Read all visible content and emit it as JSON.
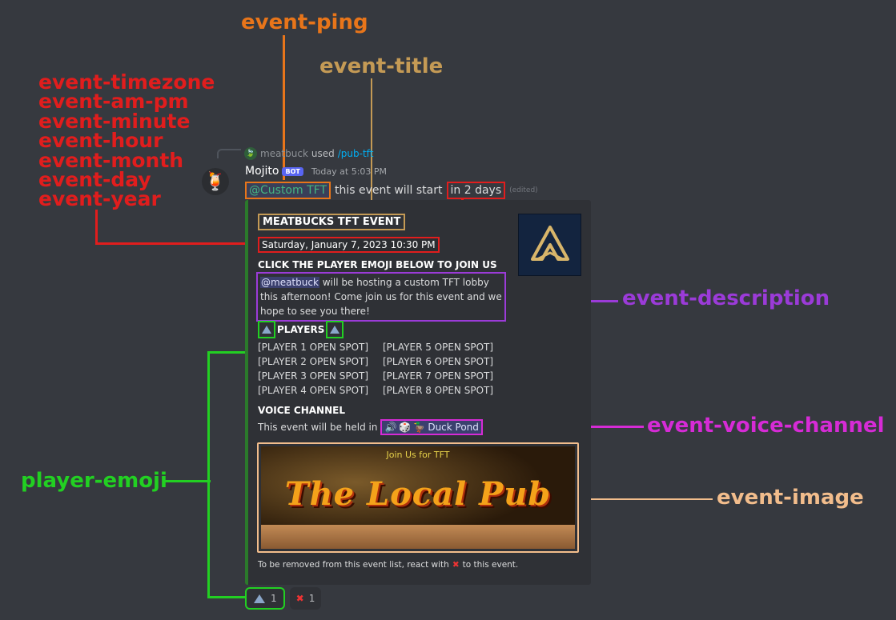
{
  "annotations": {
    "event_ping": "event-ping",
    "event_title": "event-title",
    "date_fields": [
      "event-timezone",
      "event-am-pm",
      "event-minute",
      "event-hour",
      "event-month",
      "event-day",
      "event-year"
    ],
    "event_description": "event-description",
    "event_voice_channel": "event-voice-channel",
    "player_emoji": "player-emoji",
    "event_image": "event-image"
  },
  "colors": {
    "ping": "#e8751a",
    "title": "#c49a55",
    "date": "#e11d1d",
    "description": "#9b3bd8",
    "voice": "#d62bd6",
    "player": "#22d022",
    "image": "#f2bd8c"
  },
  "reply": {
    "user": "meatbuck",
    "verb": "used",
    "command": "/pub-tft"
  },
  "message": {
    "username": "Mojito",
    "bot_tag": "BOT",
    "timestamp": "Today at 5:03 PM",
    "ping": "@Custom TFT",
    "text": "this event will start",
    "relative": "in 2 days",
    "edited": "(edited)"
  },
  "embed": {
    "title": "MEATBUCKS TFT EVENT",
    "date": "Saturday, January 7, 2023 10:30 PM",
    "join_header": "CLICK THE PLAYER EMOJI BELOW TO JOIN US",
    "desc_mention": "@meatbuck",
    "desc_text": " will be hosting a custom TFT lobby this afternoon! Come join us for this event and we hope to see you there!",
    "players_header": "PLAYERS",
    "players_left": [
      "[PLAYER 1 OPEN SPOT]",
      "[PLAYER 2 OPEN SPOT]",
      "[PLAYER 3 OPEN SPOT]",
      "[PLAYER 4 OPEN SPOT]"
    ],
    "players_right": [
      "[PLAYER 5 OPEN SPOT]",
      "[PLAYER 6 OPEN SPOT]",
      "[PLAYER 7 OPEN SPOT]",
      "[PLAYER 8 OPEN SPOT]"
    ],
    "voice_header": "VOICE CHANNEL",
    "voice_text": "This event will be held in",
    "voice_channel": "Duck Pond",
    "image_caption": "Join Us for TFT",
    "image_title": "The Local Pub",
    "footer_pre": "To be removed from this event list, react with",
    "footer_post": "to this event."
  },
  "reactions": [
    {
      "icon": "tft-icon",
      "count": "1"
    },
    {
      "icon": "x-icon",
      "count": "1"
    }
  ]
}
